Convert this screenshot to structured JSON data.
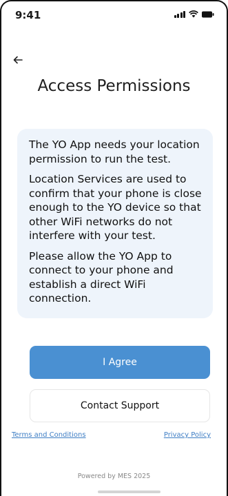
{
  "status_bar": {
    "time": "9:41",
    "icons": [
      "signal-icon",
      "wifi-icon",
      "battery-icon"
    ]
  },
  "header": {
    "back_icon": "back-arrow-icon",
    "title": "Access Permissions"
  },
  "info_card": {
    "paragraphs": [
      "The YO App needs your location permission to run the test.",
      "Location Services are used to confirm that your phone is close enough to the YO device so that other WiFi networks do not interfere with your test.",
      "Please allow the YO App to connect to your phone and establish a direct WiFi connection."
    ]
  },
  "actions": {
    "agree_label": "I Agree",
    "support_label": "Contact Support"
  },
  "links": {
    "terms": "Terms and Conditions",
    "privacy": "Privacy Policy"
  },
  "footer": {
    "powered_by": "Powered by MES 2025"
  },
  "colors": {
    "primary": "#4a90d2",
    "card_background": "#eef4fb",
    "link": "#3d7dc4"
  }
}
